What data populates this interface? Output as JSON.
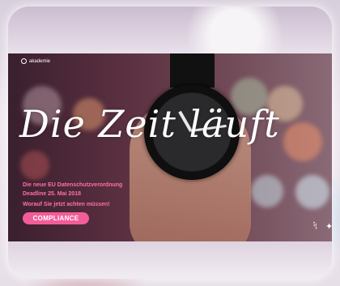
{
  "banner": {
    "logo_text": "akademie",
    "headline": "Die Zeit läuft",
    "line1": "Die neue EU Datenschutzverordnung",
    "line2": "Deadline 25. Mai 2018",
    "line3": "Worauf Sie jetzt achten müssen!",
    "cta_label": "COMPLIANCE",
    "social": [
      "xing-icon",
      "twitter-icon"
    ],
    "accent_color": "#f25d99"
  }
}
